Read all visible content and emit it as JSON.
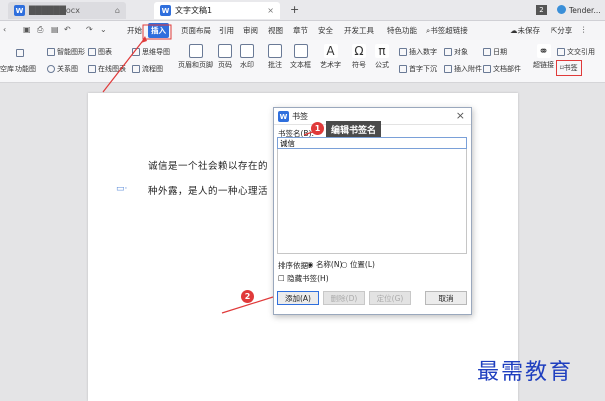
{
  "titlebar": {
    "tab1_label": "██████ocx",
    "tab2_label": "文字文稿1",
    "new_tab": "+",
    "badge_count": "2",
    "user_name": "Tender..."
  },
  "menubar": {
    "items": [
      "开始",
      "插入",
      "页面布局",
      "引用",
      "审阅",
      "视图",
      "章节",
      "安全",
      "开发工具",
      "特色功能"
    ],
    "search_text": "书签超链接",
    "unsaved": "未保存",
    "share": "分享",
    "cross_ref": "文交引用"
  },
  "ribbon": {
    "row1": [
      "智能图形",
      "图表",
      "思维导图"
    ],
    "row2": [
      "关系图",
      "在线图表",
      "流程图"
    ],
    "left_cut": "空库",
    "left_cut2": "功能图",
    "big": [
      "页眉和页脚",
      "页码",
      "水印",
      "批注",
      "文本框",
      "艺术字",
      "符号",
      "公式"
    ],
    "right_top": [
      "插入数字",
      "对象",
      "日期"
    ],
    "right_bottom": [
      "首字下沉",
      "插入附件",
      "文档部件"
    ],
    "hyperlink": "超链接",
    "bookmark": "书签"
  },
  "document": {
    "line1": "诚信是一个社会赖以存在的",
    "line2": "种外露，是人的一种心理活"
  },
  "dialog": {
    "title": "书签",
    "name_label": "书签名(B):",
    "name_value": "诚信",
    "sort_label": "排序依据:",
    "sort_name": "名称(N)",
    "sort_position": "位置(L)",
    "hidden_label": "隐藏书签(H)",
    "add_button": "添加(A)",
    "delete_button": "删除(D)",
    "goto_button": "定位(G)",
    "cancel_button": "取消"
  },
  "annotations": {
    "step1": "1",
    "step2": "2",
    "callout": "编辑书签名"
  },
  "watermark": "最需教育",
  "colors": {
    "accent": "#2f6fdd",
    "annotation": "#e03a3a"
  }
}
